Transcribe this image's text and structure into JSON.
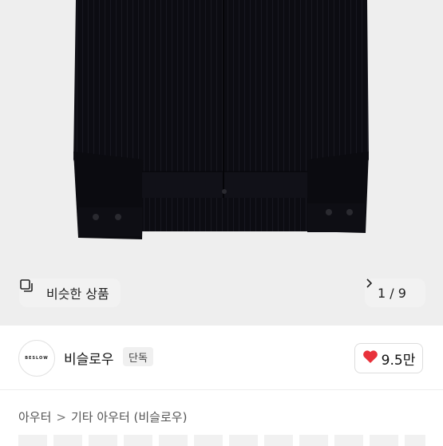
{
  "gallery": {
    "similar_label": "비슷한 상품",
    "counter": "1 / 9",
    "current": 1,
    "total": 9,
    "chevron_icon": "chevron-right-icon",
    "similar_icon": "copy-icon"
  },
  "seller": {
    "avatar_text": "BESLOW",
    "name": "비슬로우",
    "badge": "단독",
    "likes": "9.5만",
    "heart_icon": "heart-icon",
    "heart_color": "#e8313a"
  },
  "breadcrumb": {
    "items": [
      "아우터",
      "기타 아우터 (비슬로우)"
    ],
    "separator": ">"
  }
}
